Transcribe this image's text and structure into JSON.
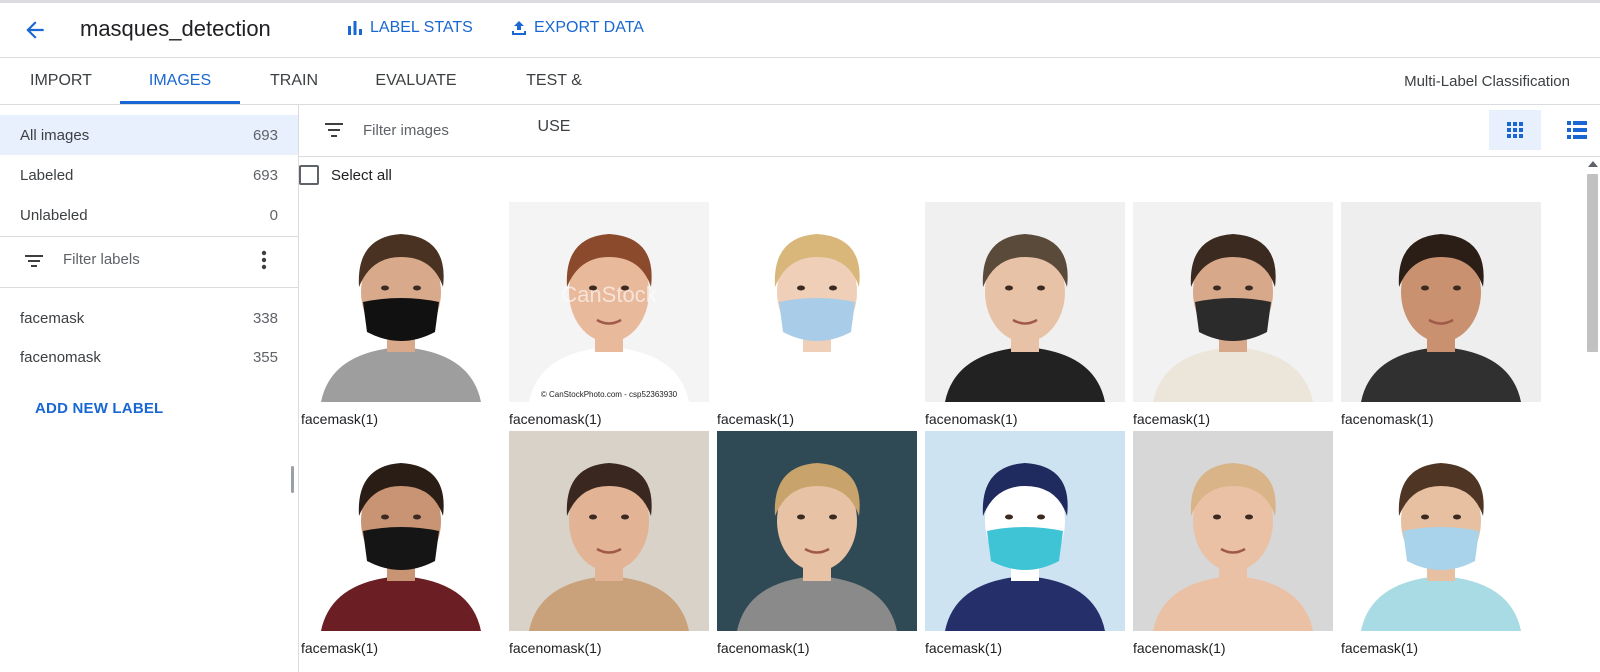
{
  "header": {
    "title": "masques_detection",
    "label_stats": "LABEL STATS",
    "export_data": "EXPORT DATA"
  },
  "tabs": [
    {
      "label": "IMPORT"
    },
    {
      "label": "IMAGES"
    },
    {
      "label": "TRAIN"
    },
    {
      "label": "EVALUATE"
    },
    {
      "label": "TEST & USE"
    }
  ],
  "active_tab": "IMAGES",
  "model_type": "Multi-Label Classification",
  "sidebar": {
    "filters": [
      {
        "label": "All images",
        "count": "693"
      },
      {
        "label": "Labeled",
        "count": "693"
      },
      {
        "label": "Unlabeled",
        "count": "0"
      }
    ],
    "filter_labels_placeholder": "Filter labels",
    "labels": [
      {
        "label": "facemask",
        "count": "338"
      },
      {
        "label": "facenomask",
        "count": "355"
      }
    ],
    "add_label": "ADD NEW LABEL"
  },
  "main": {
    "filter_placeholder": "Filter images",
    "select_all": "Select all",
    "images": [
      {
        "caption": "facemask(1)",
        "bg": "#ffffff",
        "skin": "#d9a98c",
        "hair": "#4a3222",
        "shirt": "#9e9e9e",
        "mask": "#111111"
      },
      {
        "caption": "facenomask(1)",
        "bg": "#f4f4f4",
        "skin": "#e9b99c",
        "hair": "#8b4a2b",
        "shirt": "#ffffff",
        "mask": "",
        "watermark": "CanStock",
        "footnote": "© CanStockPhoto.com - csp52363930"
      },
      {
        "caption": "facemask(1)",
        "bg": "#ffffff",
        "skin": "#efcfb8",
        "hair": "#d9b77a",
        "shirt": "#ffffff",
        "mask": "#a9cde9"
      },
      {
        "caption": "facenomask(1)",
        "bg": "#f0f0f0",
        "skin": "#e8c2a6",
        "hair": "#5a4a3a",
        "shirt": "#222222",
        "mask": ""
      },
      {
        "caption": "facemask(1)",
        "bg": "#f2f2f2",
        "skin": "#d8a88a",
        "hair": "#3b2a20",
        "shirt": "#ece6da",
        "mask": "#2b2b2b"
      },
      {
        "caption": "facenomask(1)",
        "bg": "#eeeeee",
        "skin": "#c9916f",
        "hair": "#2b1e16",
        "shirt": "#303030",
        "mask": ""
      },
      {
        "caption": "facemask(1)",
        "bg": "#ffffff",
        "skin": "#c99474",
        "hair": "#2a1d16",
        "shirt": "#6b1f24",
        "mask": "#151515"
      },
      {
        "caption": "facenomask(1)",
        "bg": "#d8d2c8",
        "skin": "#e2b394",
        "hair": "#3a2820",
        "shirt": "#c9a17a",
        "mask": ""
      },
      {
        "caption": "facenomask(1)",
        "bg": "#2f4a55",
        "skin": "#e7c2a4",
        "hair": "#c8a36b",
        "shirt": "#8a8a8a",
        "mask": ""
      },
      {
        "caption": "facemask(1)",
        "bg": "#cde3f2",
        "skin": "#ffffff",
        "hair": "#1f2a5e",
        "shirt": "#25306a",
        "mask": "#3fc4d6"
      },
      {
        "caption": "facenomask(1)",
        "bg": "#d7d7d7",
        "skin": "#eac1a4",
        "hair": "#d9b488",
        "shirt": "#eac1a4",
        "mask": ""
      },
      {
        "caption": "facemask(1)",
        "bg": "#ffffff",
        "skin": "#e7c0a2",
        "hair": "#4e3524",
        "shirt": "#a8dbe4",
        "mask": "#a9d3ea"
      }
    ]
  },
  "colors": {
    "accent": "#1967d2",
    "selected_bg": "#e8f0fe",
    "divider": "#dadce0"
  },
  "icons": {
    "back": "arrow-left-icon",
    "label_stats": "bar-chart-icon",
    "export_data": "upload-icon",
    "filter": "filter-list-icon",
    "more": "more-vert-icon",
    "grid_view": "grid-view-icon",
    "list_view": "list-view-icon"
  }
}
